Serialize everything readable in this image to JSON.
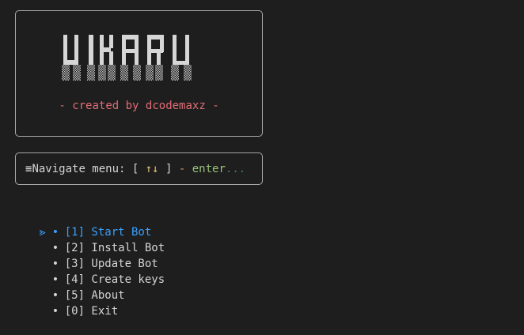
{
  "banner": {
    "logo_text": "VIKARU",
    "tagline": "- created by dcodemaxz -"
  },
  "nav": {
    "icon": "hamburger-icon",
    "label": "Navigate menu: [ ",
    "arrows": "↑↓",
    "close_bracket": " ]",
    "separator": " - ",
    "enter": "enter",
    "dots": "..."
  },
  "menu": {
    "cursor": "⪢",
    "bullet": "•",
    "items": [
      {
        "label": "[1] Start Bot",
        "selected": true
      },
      {
        "label": "[2] Install Bot",
        "selected": false
      },
      {
        "label": "[3] Update Bot",
        "selected": false
      },
      {
        "label": "[4] Create keys",
        "selected": false
      },
      {
        "label": "[5] About",
        "selected": false
      },
      {
        "label": "[0] Exit",
        "selected": false
      }
    ]
  },
  "colors": {
    "background": "#1e1e1e",
    "tagline": "#e06c75",
    "selected": "#3aa0ff",
    "enter": "#98c379",
    "arrows": "#e5c07b"
  }
}
